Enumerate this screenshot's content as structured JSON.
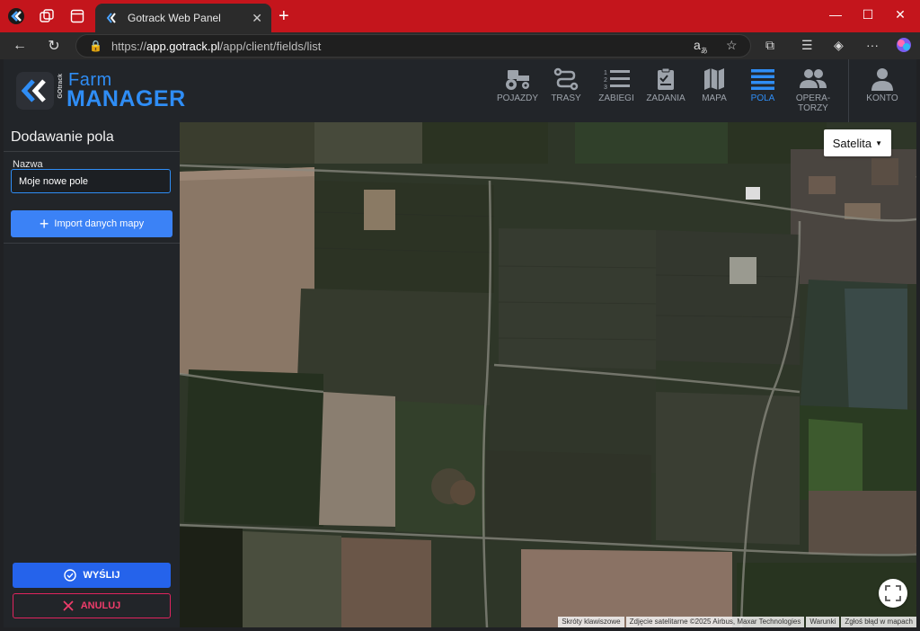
{
  "browser": {
    "tab_title": "Gotrack Web Panel",
    "url_prefix": "https://",
    "url_host": "app.gotrack.pl",
    "url_path": "/app/client/fields/list"
  },
  "logo": {
    "gotrack": "GOtrack",
    "farm": "Farm",
    "manager": "MANAGER"
  },
  "nav": {
    "items": [
      {
        "label": "POJAZDY",
        "icon": "tractor-icon"
      },
      {
        "label": "TRASY",
        "icon": "route-icon"
      },
      {
        "label": "ZABIEGI",
        "icon": "list-icon"
      },
      {
        "label": "ZADANIA",
        "icon": "tasks-icon"
      },
      {
        "label": "MAPA",
        "icon": "map-icon"
      },
      {
        "label": "POLA",
        "icon": "fields-icon"
      },
      {
        "label": "OPERA-",
        "label2": "TORZY",
        "icon": "operators-icon"
      },
      {
        "label": "KONTO",
        "icon": "account-icon"
      }
    ],
    "active": "POLA",
    "active_color": "#2f8df5"
  },
  "sidebar": {
    "title": "Dodawanie pola",
    "name_label": "Nazwa",
    "name_value": "Moje nowe pole",
    "import_label": "Import danych mapy",
    "send_label": "WYŚLIJ",
    "cancel_label": "ANULUJ"
  },
  "map": {
    "type_label": "Satelita",
    "attribution": {
      "shortcuts": "Skróty klawiszowe",
      "imagery": "Zdjęcie satelitarne ©2025 Airbus, Maxar Technologies",
      "terms": "Warunki",
      "report": "Zgłoś błąd w mapach"
    }
  }
}
